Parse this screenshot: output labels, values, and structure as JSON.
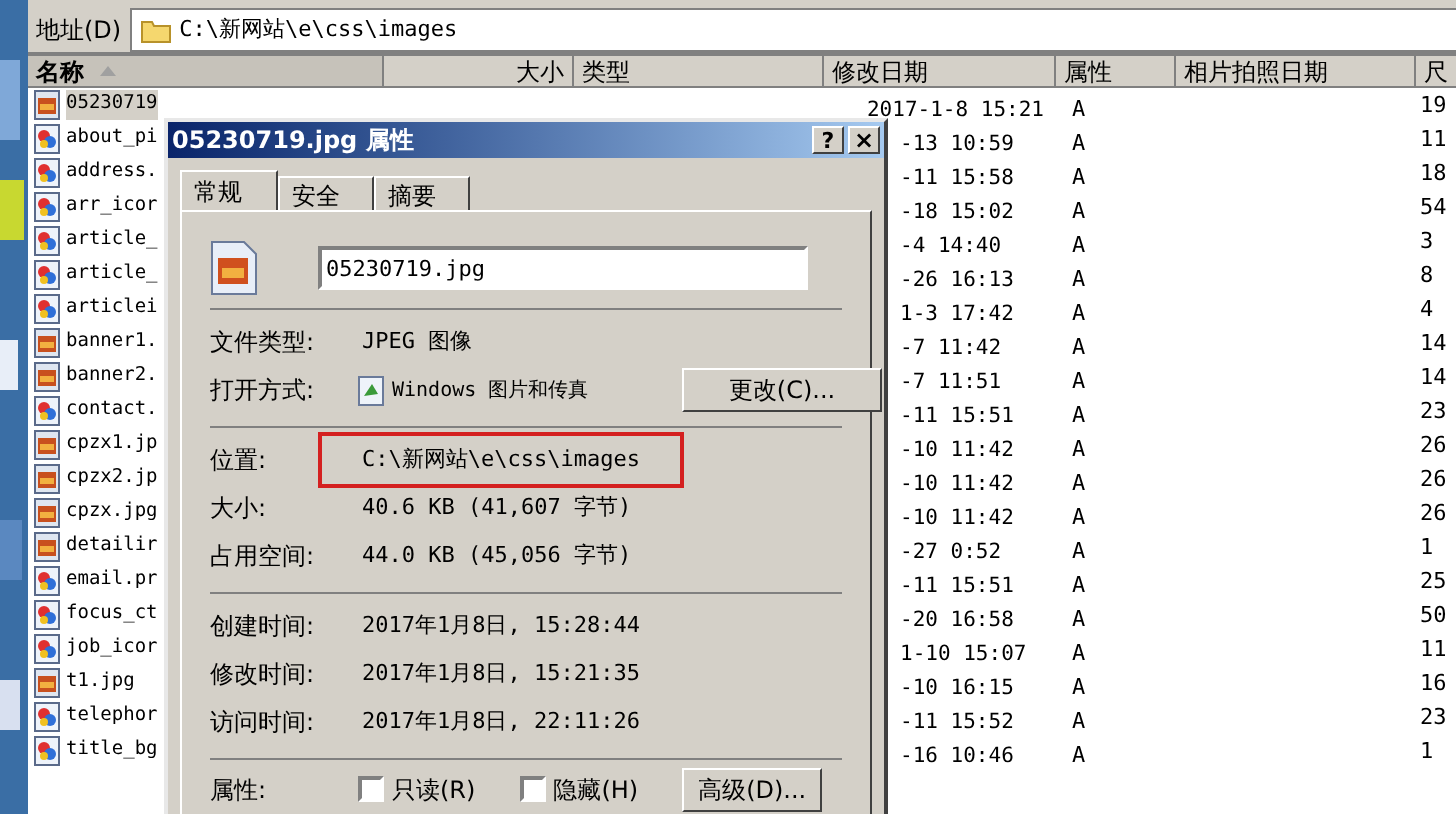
{
  "address_bar": {
    "label": "地址(D)",
    "path": "C:\\新网站\\e\\css\\images"
  },
  "columns": [
    {
      "label": "名称",
      "sorted": true
    },
    {
      "label": "大小",
      "sorted": false
    },
    {
      "label": "类型",
      "sorted": false
    },
    {
      "label": "修改日期",
      "sorted": false
    },
    {
      "label": "属性",
      "sorted": false
    },
    {
      "label": "相片拍照日期",
      "sorted": false
    },
    {
      "label": "尺",
      "sorted": false
    }
  ],
  "files": [
    {
      "name": "05230719",
      "kind": "photo",
      "selected": true,
      "modified": "2017-1-8 15:21",
      "attributes": "A",
      "column_7": "19"
    },
    {
      "name": "about_pi",
      "kind": "png",
      "selected": false,
      "modified": "-13 10:59",
      "attributes": "A",
      "column_7": "11"
    },
    {
      "name": "address.",
      "kind": "png",
      "selected": false,
      "modified": "-11 15:58",
      "attributes": "A",
      "column_7": "18"
    },
    {
      "name": "arr_icor",
      "kind": "png",
      "selected": false,
      "modified": "-18 15:02",
      "attributes": "A",
      "column_7": "54"
    },
    {
      "name": "article_",
      "kind": "png",
      "selected": false,
      "modified": "-4 14:40",
      "attributes": "A",
      "column_7": "3"
    },
    {
      "name": "article_",
      "kind": "png",
      "selected": false,
      "modified": "-26 16:13",
      "attributes": "A",
      "column_7": "8"
    },
    {
      "name": "articlei",
      "kind": "png",
      "selected": false,
      "modified": "1-3 17:42",
      "attributes": "A",
      "column_7": "4"
    },
    {
      "name": "banner1.",
      "kind": "photo",
      "selected": false,
      "modified": "-7 11:42",
      "attributes": "A",
      "column_7": "14"
    },
    {
      "name": "banner2.",
      "kind": "photo",
      "selected": false,
      "modified": "-7 11:51",
      "attributes": "A",
      "column_7": "14"
    },
    {
      "name": "contact.",
      "kind": "png",
      "selected": false,
      "modified": "-11 15:51",
      "attributes": "A",
      "column_7": "23"
    },
    {
      "name": "cpzx1.jp",
      "kind": "photo",
      "selected": false,
      "modified": "-10 11:42",
      "attributes": "A",
      "column_7": "26"
    },
    {
      "name": "cpzx2.jp",
      "kind": "photo",
      "selected": false,
      "modified": "-10 11:42",
      "attributes": "A",
      "column_7": "26"
    },
    {
      "name": "cpzx.jpg",
      "kind": "photo",
      "selected": false,
      "modified": "-10 11:42",
      "attributes": "A",
      "column_7": "26"
    },
    {
      "name": "detailir",
      "kind": "photo",
      "selected": false,
      "modified": "-27 0:52",
      "attributes": "A",
      "column_7": "1"
    },
    {
      "name": "email.pr",
      "kind": "png",
      "selected": false,
      "modified": "-11 15:51",
      "attributes": "A",
      "column_7": "25"
    },
    {
      "name": "focus_ct",
      "kind": "png",
      "selected": false,
      "modified": "-20 16:58",
      "attributes": "A",
      "column_7": "50"
    },
    {
      "name": "job_icor",
      "kind": "png",
      "selected": false,
      "modified": "1-10 15:07",
      "attributes": "A",
      "column_7": "11"
    },
    {
      "name": "t1.jpg",
      "kind": "photo",
      "selected": false,
      "modified": "-10 16:15",
      "attributes": "A",
      "column_7": "16"
    },
    {
      "name": "telephor",
      "kind": "png",
      "selected": false,
      "modified": "-11 15:52",
      "attributes": "A",
      "column_7": "23"
    },
    {
      "name": "title_bg",
      "kind": "png",
      "selected": false,
      "modified": "-16 10:46",
      "attributes": "A",
      "column_7": "1"
    }
  ],
  "dialog": {
    "title": "05230719.jpg 属性",
    "help": "?",
    "close": "×",
    "tabs": [
      {
        "label": "常规",
        "selected": true
      },
      {
        "label": "安全",
        "selected": false
      },
      {
        "label": "摘要",
        "selected": false
      }
    ],
    "file_name": "05230719.jpg",
    "groups": [
      [
        {
          "label": "文件类型:",
          "value": "JPEG 图像",
          "kind": "text"
        },
        {
          "label": "打开方式:",
          "value": "Windows 图片和传真",
          "kind": "program",
          "button": "更改(C)..."
        }
      ],
      [
        {
          "label": "位置:",
          "value": "C:\\新网站\\e\\css\\images",
          "kind": "text",
          "highlighted": true
        },
        {
          "label": "大小:",
          "value": "40.6 KB (41,607 字节)",
          "kind": "text",
          "highlighted": false
        },
        {
          "label": "占用空间:",
          "value": "44.0 KB (45,056 字节)",
          "kind": "text",
          "highlighted": false
        }
      ],
      [
        {
          "label": "创建时间:",
          "value": "2017年1月8日, 15:28:44",
          "kind": "text"
        },
        {
          "label": "修改时间:",
          "value": "2017年1月8日, 15:21:35",
          "kind": "text"
        },
        {
          "label": "访问时间:",
          "value": "2017年1月8日, 22:11:26",
          "kind": "text"
        }
      ]
    ],
    "attributes": {
      "label": "属性:",
      "checkboxes": [
        {
          "label": "只读(R)",
          "checked": false
        },
        {
          "label": "隐藏(H)",
          "checked": false
        }
      ],
      "button": "高级(D)..."
    }
  }
}
